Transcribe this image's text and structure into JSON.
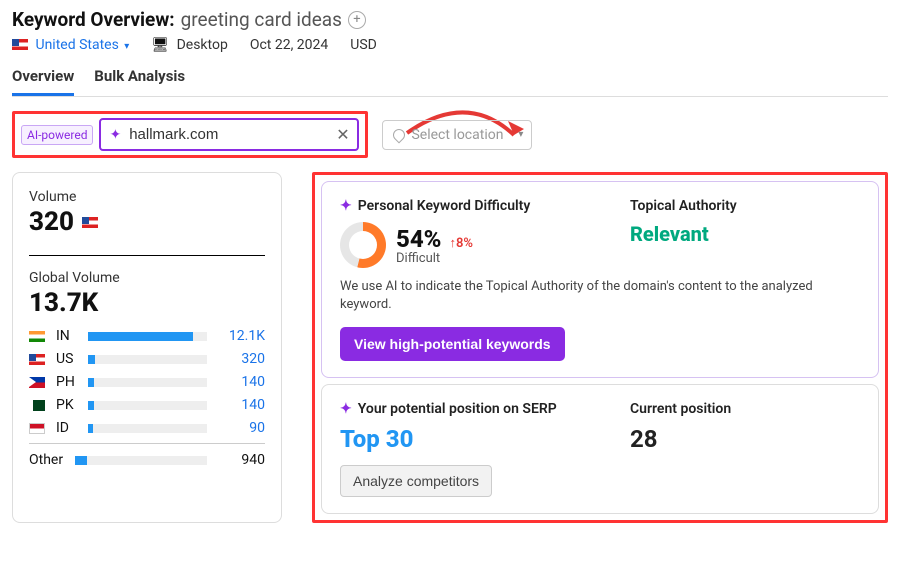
{
  "header": {
    "label": "Keyword Overview:",
    "keyword": "greeting card ideas"
  },
  "meta": {
    "location": "United States",
    "device": "Desktop",
    "date": "Oct 22, 2024",
    "currency": "USD"
  },
  "tabs": {
    "overview": "Overview",
    "bulk": "Bulk Analysis"
  },
  "filters": {
    "ai_badge": "AI-powered",
    "domain_value": "hallmark.com",
    "location_placeholder": "Select location"
  },
  "volume": {
    "label": "Volume",
    "value": "320",
    "global_label": "Global Volume",
    "global_value": "13.7K",
    "rows": [
      {
        "flag": "in",
        "cc": "IN",
        "value": "12.1K",
        "pct": 88
      },
      {
        "flag": "us",
        "cc": "US",
        "value": "320",
        "pct": 6
      },
      {
        "flag": "ph",
        "cc": "PH",
        "value": "140",
        "pct": 5
      },
      {
        "flag": "pk",
        "cc": "PK",
        "value": "140",
        "pct": 5
      },
      {
        "flag": "id",
        "cc": "ID",
        "value": "90",
        "pct": 4
      }
    ],
    "other_label": "Other",
    "other_value": "940",
    "other_pct": 9
  },
  "pkd": {
    "title": "Personal Keyword Difficulty",
    "percent": "54%",
    "delta": "8%",
    "difficulty_label": "Difficult",
    "authority_title": "Topical Authority",
    "authority_value": "Relevant",
    "description": "We use AI to indicate the Topical Authority of the domain's content to the analyzed keyword.",
    "cta": "View high-potential keywords"
  },
  "serp": {
    "title": "Your potential position on SERP",
    "potential": "Top 30",
    "current_title": "Current position",
    "current_value": "28",
    "cta": "Analyze competitors"
  }
}
